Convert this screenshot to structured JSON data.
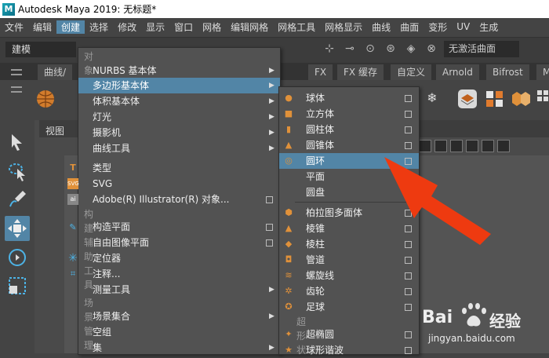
{
  "window": {
    "title": "Autodesk Maya 2019: 无标题*",
    "logo": "M"
  },
  "menubar": {
    "items": [
      "文件",
      "编辑",
      "创建",
      "选择",
      "修改",
      "显示",
      "窗口",
      "网格",
      "编辑网格",
      "网格工具",
      "网格显示",
      "曲线",
      "曲面",
      "变形",
      "UV",
      "生成"
    ],
    "active_index": 2
  },
  "status": {
    "mode": "建模",
    "live_object": "无激活曲面"
  },
  "shelf": {
    "tabs": [
      "曲线/",
      "FX",
      "FX 缓存",
      "自定义",
      "Arnold",
      "Bifrost",
      "M"
    ]
  },
  "viewport": {
    "label": "视图"
  },
  "create_menu": {
    "sections": {
      "objects": "对象",
      "construction": "构建辅助工具",
      "scene": "场景管理"
    },
    "items": [
      {
        "label": "NURBS 基本体",
        "submenu": true
      },
      {
        "label": "多边形基本体",
        "submenu": true,
        "highlighted": true
      },
      {
        "label": "体积基本体",
        "submenu": true
      },
      {
        "label": "灯光",
        "submenu": true
      },
      {
        "label": "摄影机",
        "submenu": true
      },
      {
        "label": "曲线工具",
        "submenu": true
      },
      {
        "label": "类型"
      },
      {
        "label": "SVG"
      },
      {
        "label": "Adobe(R) Illustrator(R) 对象...",
        "option_box": true
      },
      {
        "label": "构造平面",
        "option_box": true
      },
      {
        "label": "自由图像平面",
        "option_box": true
      },
      {
        "label": "定位器"
      },
      {
        "label": "注释..."
      },
      {
        "label": "测量工具",
        "submenu": true
      },
      {
        "label": "场景集合",
        "submenu": true
      },
      {
        "label": "空组"
      },
      {
        "label": "集",
        "submenu": true
      }
    ]
  },
  "poly_menu": {
    "section_superformula": "超形状",
    "items": [
      "球体",
      "立方体",
      "圆柱体",
      "圆锥体",
      "圆环",
      "平面",
      "圆盘",
      "柏拉图多面体",
      "棱锥",
      "棱柱",
      "管道",
      "螺旋线",
      "齿轮",
      "足球",
      "超椭圆",
      "球形谐波"
    ],
    "highlighted_index": 4
  },
  "annotation": {
    "arrow_color": "#ee3a10"
  },
  "watermark": {
    "brand": "Bai",
    "brand2": "经验",
    "url": "jingyan.baidu.com"
  }
}
